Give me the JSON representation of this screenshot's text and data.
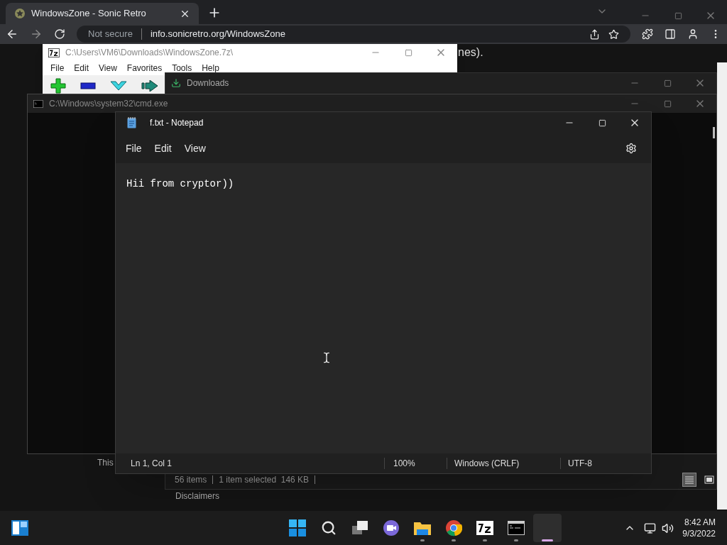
{
  "browser": {
    "tabs": [
      {
        "title": "WindowsZone - Sonic Retro",
        "selected": true
      }
    ],
    "security_label": "Not secure",
    "url": "info.sonicretro.org/WindowsZone",
    "page_texts": [
      "nes).",
      "This",
      "Disclaimers"
    ]
  },
  "sevenzip": {
    "title": "C:\\Users\\VM6\\Downloads\\WindowsZone.7z\\",
    "menu": [
      "File",
      "Edit",
      "View",
      "Favorites",
      "Tools",
      "Help"
    ],
    "tools": [
      {
        "kind": "add"
      },
      {
        "kind": "delete"
      },
      {
        "kind": "extract"
      },
      {
        "kind": "move"
      }
    ]
  },
  "explorer": {
    "title": "Downloads",
    "status": [
      "56 items",
      "1 item selected  146 KB"
    ],
    "views": [
      {
        "kind": "details",
        "selected": true
      },
      {
        "kind": "tiles",
        "selected": false
      }
    ]
  },
  "cmd": {
    "title": "C:\\Windows\\system32\\cmd.exe"
  },
  "notepad": {
    "title": "f.txt - Notepad",
    "menu": [
      "File",
      "Edit",
      "View"
    ],
    "text": "Hii from cryptor))",
    "status": [
      "Ln 1, Col 1",
      "100%",
      "Windows (CRLF)",
      "UTF-8"
    ]
  },
  "taskbar": {
    "apps": [
      {
        "kind": "start",
        "running": false,
        "selected": false
      },
      {
        "kind": "search",
        "running": false,
        "selected": false
      },
      {
        "kind": "taskview",
        "running": false,
        "selected": false
      },
      {
        "kind": "chat",
        "running": false,
        "selected": false
      },
      {
        "kind": "files",
        "running": true,
        "selected": false
      },
      {
        "kind": "browser",
        "running": true,
        "selected": false
      },
      {
        "kind": "archiver",
        "running": true,
        "selected": false
      },
      {
        "kind": "terminal",
        "running": true,
        "selected": false
      },
      {
        "kind": "notepad",
        "running": true,
        "selected": true
      }
    ],
    "time": "8:42 AM",
    "date": "9/3/2022"
  }
}
